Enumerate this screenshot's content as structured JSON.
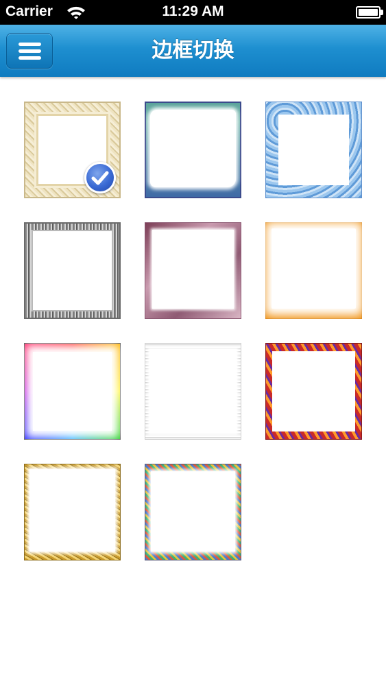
{
  "status_bar": {
    "carrier": "Carrier",
    "time": "11:29 AM",
    "wifi_icon": "wifi-icon",
    "battery_icon": "battery-icon"
  },
  "nav_bar": {
    "title": "边框切换",
    "menu_icon": "hamburger-menu-icon",
    "background_color": "#1e8fd0"
  },
  "frames": [
    {
      "style": "ornate-cream",
      "selected": true
    },
    {
      "style": "teal-blue-floral",
      "selected": false
    },
    {
      "style": "blue-waves",
      "selected": false
    },
    {
      "style": "silver-chain",
      "selected": false
    },
    {
      "style": "mauve-crystals",
      "selected": false
    },
    {
      "style": "orange-dotted",
      "selected": false
    },
    {
      "style": "rainbow",
      "selected": false
    },
    {
      "style": "light-silver",
      "selected": false
    },
    {
      "style": "red-orange-twisted",
      "selected": false
    },
    {
      "style": "gold-branches",
      "selected": false
    },
    {
      "style": "multicolor-tiles",
      "selected": false
    }
  ],
  "selection_badge_icon": "check-circle-icon",
  "accent_color": "#3a6ad4"
}
